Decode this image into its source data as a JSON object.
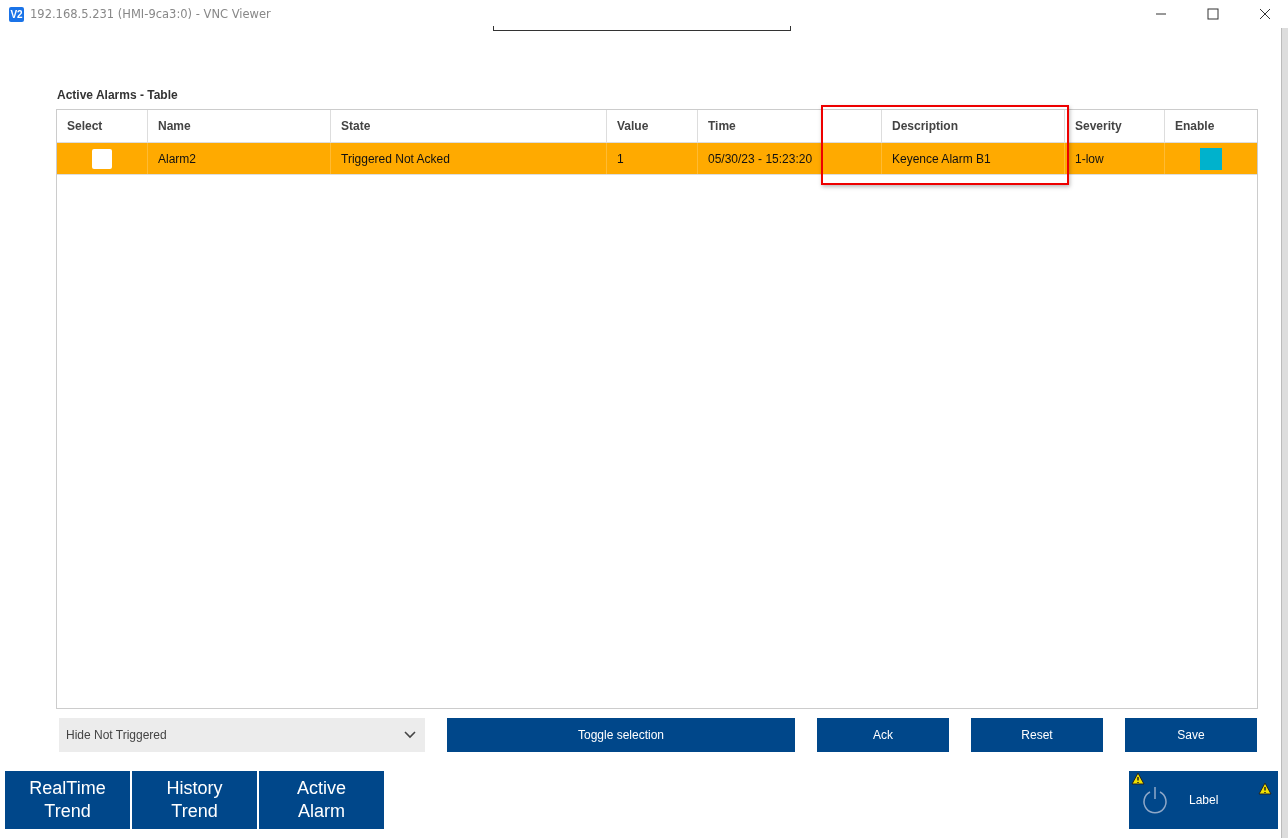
{
  "window": {
    "title": "192.168.5.231 (HMI-9ca3:0) - VNC Viewer",
    "logo": "V2"
  },
  "table": {
    "title": "Active Alarms - Table",
    "columns": [
      {
        "kind": "header",
        "label": "Select"
      },
      {
        "kind": "header",
        "label": "Name"
      },
      {
        "kind": "header",
        "label": "State"
      },
      {
        "kind": "header",
        "label": "Value"
      },
      {
        "kind": "header",
        "label": "Time"
      },
      {
        "kind": "blank"
      },
      {
        "kind": "header",
        "label": "Description"
      },
      {
        "kind": "header",
        "label": "Severity"
      },
      {
        "kind": "header",
        "label": "Enable"
      }
    ],
    "annotation": {
      "kind": "red-box"
    },
    "rows": [
      {
        "selected": false,
        "color": "#ffaa00",
        "name": "Alarm2",
        "state": "Triggered Not Acked",
        "value": "1",
        "time": "05/30/23 - 15:23:20",
        "description": "Keyence Alarm B1",
        "severity": "1-low",
        "enabled": true
      }
    ]
  },
  "filter": {
    "value": "Hide Not Triggered"
  },
  "buttons": [
    "Toggle selection",
    "Ack",
    "Reset",
    "Save"
  ],
  "nav": [
    "RealTime Trend",
    "History Trend",
    "Active Alarm"
  ],
  "status_panel": {
    "label": "Label"
  }
}
